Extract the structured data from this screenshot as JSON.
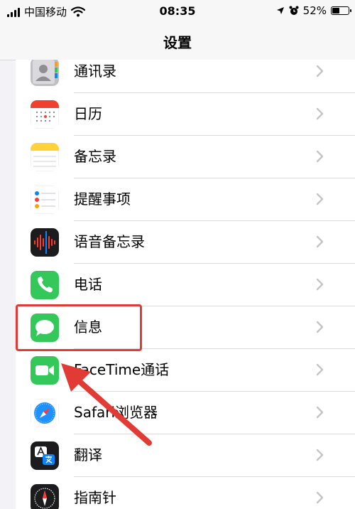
{
  "status_bar": {
    "carrier": "中国移动",
    "time": "08:35",
    "battery_percent": "52%",
    "battery_level": 0.52,
    "icons": [
      "signal-icon",
      "wifi-icon",
      "location-icon",
      "alarm-icon",
      "battery-icon"
    ]
  },
  "nav": {
    "title": "设置"
  },
  "settings_items": [
    {
      "label": "通讯录",
      "icon": "contacts-icon"
    },
    {
      "label": "日历",
      "icon": "calendar-icon"
    },
    {
      "label": "备忘录",
      "icon": "notes-icon"
    },
    {
      "label": "提醒事项",
      "icon": "reminders-icon"
    },
    {
      "label": "语音备忘录",
      "icon": "voice-memos-icon"
    },
    {
      "label": "电话",
      "icon": "phone-icon"
    },
    {
      "label": "信息",
      "icon": "messages-icon"
    },
    {
      "label": "FaceTime通话",
      "icon": "facetime-icon"
    },
    {
      "label": "Safari浏览器",
      "icon": "safari-icon"
    },
    {
      "label": "翻译",
      "icon": "translate-icon"
    },
    {
      "label": "指南针",
      "icon": "compass-icon"
    }
  ],
  "colors": {
    "highlight": "#e23b35",
    "arrow": "#e23b35",
    "green": "#34c759",
    "chevron": "#c4c4c7"
  }
}
